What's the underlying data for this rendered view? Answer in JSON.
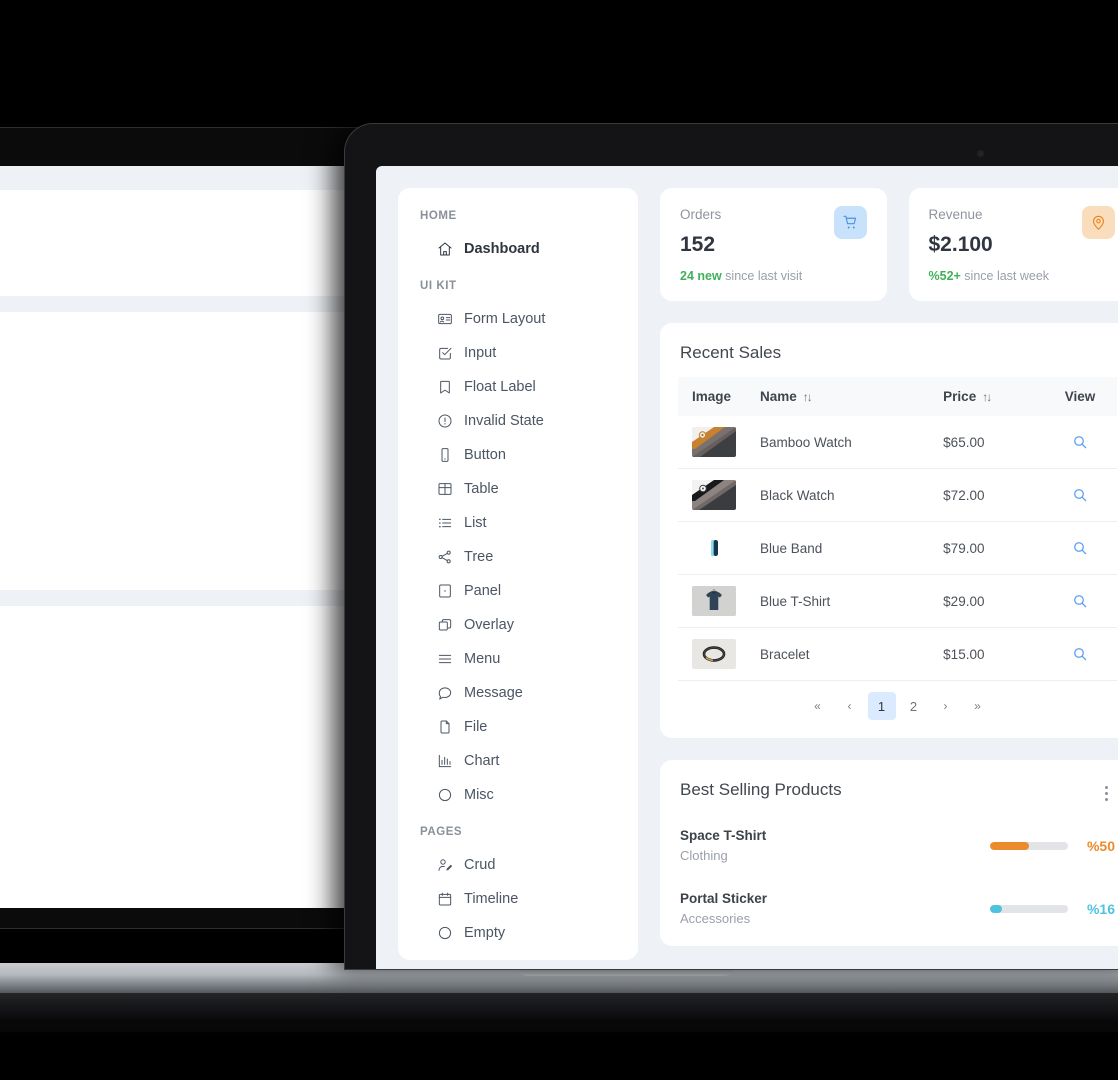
{
  "sidebar": {
    "sections": [
      {
        "title": "HOME",
        "items": [
          {
            "label": "Dashboard",
            "icon": "home-icon",
            "active": true
          }
        ]
      },
      {
        "title": "UI KIT",
        "items": [
          {
            "label": "Form Layout",
            "icon": "id-card-icon",
            "active": false
          },
          {
            "label": "Input",
            "icon": "checkbox-icon",
            "active": false
          },
          {
            "label": "Float Label",
            "icon": "bookmark-icon",
            "active": false
          },
          {
            "label": "Invalid State",
            "icon": "exclamation-circle-icon",
            "active": false
          },
          {
            "label": "Button",
            "icon": "mobile-icon",
            "active": false
          },
          {
            "label": "Table",
            "icon": "table-icon",
            "active": false
          },
          {
            "label": "List",
            "icon": "list-icon",
            "active": false
          },
          {
            "label": "Tree",
            "icon": "share-nodes-icon",
            "active": false
          },
          {
            "label": "Panel",
            "icon": "panel-icon",
            "active": false
          },
          {
            "label": "Overlay",
            "icon": "clone-icon",
            "active": false
          },
          {
            "label": "Menu",
            "icon": "bars-icon",
            "active": false
          },
          {
            "label": "Message",
            "icon": "comment-icon",
            "active": false
          },
          {
            "label": "File",
            "icon": "file-icon",
            "active": false
          },
          {
            "label": "Chart",
            "icon": "chart-bar-icon",
            "active": false
          },
          {
            "label": "Misc",
            "icon": "circle-icon",
            "active": false
          }
        ]
      },
      {
        "title": "PAGES",
        "items": [
          {
            "label": "Crud",
            "icon": "user-edit-icon",
            "active": false
          },
          {
            "label": "Timeline",
            "icon": "calendar-icon",
            "active": false
          },
          {
            "label": "Empty",
            "icon": "circle-icon",
            "active": false
          }
        ]
      }
    ]
  },
  "stats": [
    {
      "label": "Orders",
      "value": "152",
      "highlight": "24 new",
      "sub": " since last visit",
      "icon": "shopping-cart-icon",
      "badge_class": "badge-blue",
      "icon_color": "#4a90e2"
    },
    {
      "label": "Revenue",
      "value": "$2.100",
      "highlight": "%52+",
      "sub": " since last week",
      "icon": "map-marker-icon",
      "badge_class": "badge-orange",
      "icon_color": "#e8871e"
    }
  ],
  "recent_sales": {
    "title": "Recent Sales",
    "columns": [
      "Image",
      "Name",
      "Price",
      "View"
    ],
    "sortable": [
      "Name",
      "Price"
    ],
    "sort_glyph": "↑↓",
    "rows": [
      {
        "name": "Bamboo Watch",
        "price": "$65.00",
        "thumb": "bamboo-watch-thumb"
      },
      {
        "name": "Black Watch",
        "price": "$72.00",
        "thumb": "black-watch-thumb"
      },
      {
        "name": "Blue Band",
        "price": "$79.00",
        "thumb": "blue-band-thumb"
      },
      {
        "name": "Blue T-Shirt",
        "price": "$29.00",
        "thumb": "blue-tshirt-thumb"
      },
      {
        "name": "Bracelet",
        "price": "$15.00",
        "thumb": "bracelet-thumb"
      }
    ],
    "pagination": {
      "first": "«",
      "prev": "‹",
      "pages": [
        "1",
        "2"
      ],
      "current": "1",
      "next": "›",
      "last": "»"
    }
  },
  "best_selling": {
    "title": "Best Selling Products",
    "menu_icon": "kebab-menu-icon",
    "items": [
      {
        "name": "Space T-Shirt",
        "category": "Clothing",
        "percent": "%50",
        "value": 50,
        "color": "#ec8b2b"
      },
      {
        "name": "Portal Sticker",
        "category": "Accessories",
        "percent": "%16",
        "value": 16,
        "color": "#4ec3e0"
      }
    ]
  },
  "theme": {
    "page_bg": "#eef1f5",
    "card_bg": "#ffffff",
    "accent_blue": "#4a90e2",
    "accent_orange": "#e8871e",
    "accent_green": "#40b05a",
    "text_dark": "#2f3640",
    "text_muted": "#8f949d"
  }
}
